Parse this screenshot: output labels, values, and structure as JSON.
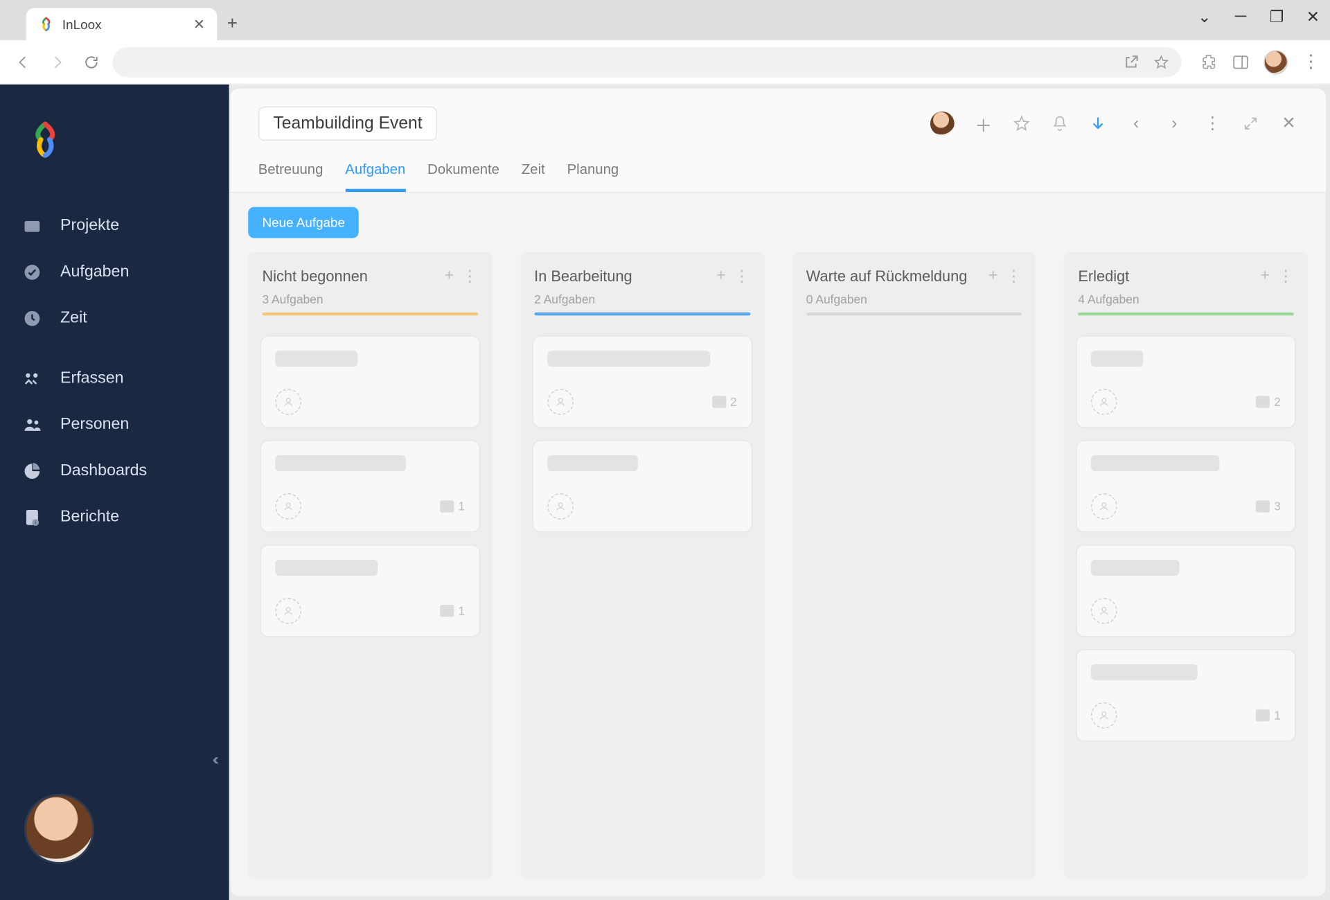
{
  "browser": {
    "tab_title": "InLoox"
  },
  "sidebar": {
    "items": [
      {
        "icon": "folder",
        "label": "Projekte"
      },
      {
        "icon": "check",
        "label": "Aufgaben"
      },
      {
        "icon": "clock",
        "label": "Zeit"
      },
      {
        "icon": "capture",
        "label": "Erfassen"
      },
      {
        "icon": "people",
        "label": "Personen"
      },
      {
        "icon": "pie",
        "label": "Dashboards"
      },
      {
        "icon": "report",
        "label": "Berichte"
      }
    ]
  },
  "project": {
    "title": "Teambuilding Event",
    "tabs": [
      "Betreuung",
      "Aufgaben",
      "Dokumente",
      "Zeit",
      "Planung"
    ],
    "active_tab": 1,
    "new_task_label": "Neue Aufgabe"
  },
  "columns": [
    {
      "title": "Nicht begonnen",
      "count_label": "3 Aufgaben",
      "color": "c-orange",
      "cards": [
        {
          "skel_w": 82,
          "comments": null
        },
        {
          "skel_w": 130,
          "comments": "1"
        },
        {
          "skel_w": 102,
          "comments": "1"
        }
      ]
    },
    {
      "title": "In Bearbeitung",
      "count_label": "2 Aufgaben",
      "color": "c-blue",
      "cards": [
        {
          "skel_w": 162,
          "comments": "2"
        },
        {
          "skel_w": 90,
          "comments": null
        }
      ]
    },
    {
      "title": "Warte auf Rückmeldung",
      "count_label": "0 Aufgaben",
      "color": "c-grey",
      "cards": []
    },
    {
      "title": "Erledigt",
      "count_label": "4 Aufgaben",
      "color": "c-green",
      "cards": [
        {
          "skel_w": 52,
          "comments": "2"
        },
        {
          "skel_w": 128,
          "comments": "3"
        },
        {
          "skel_w": 88,
          "comments": null
        },
        {
          "skel_w": 106,
          "comments": "1"
        }
      ]
    }
  ]
}
